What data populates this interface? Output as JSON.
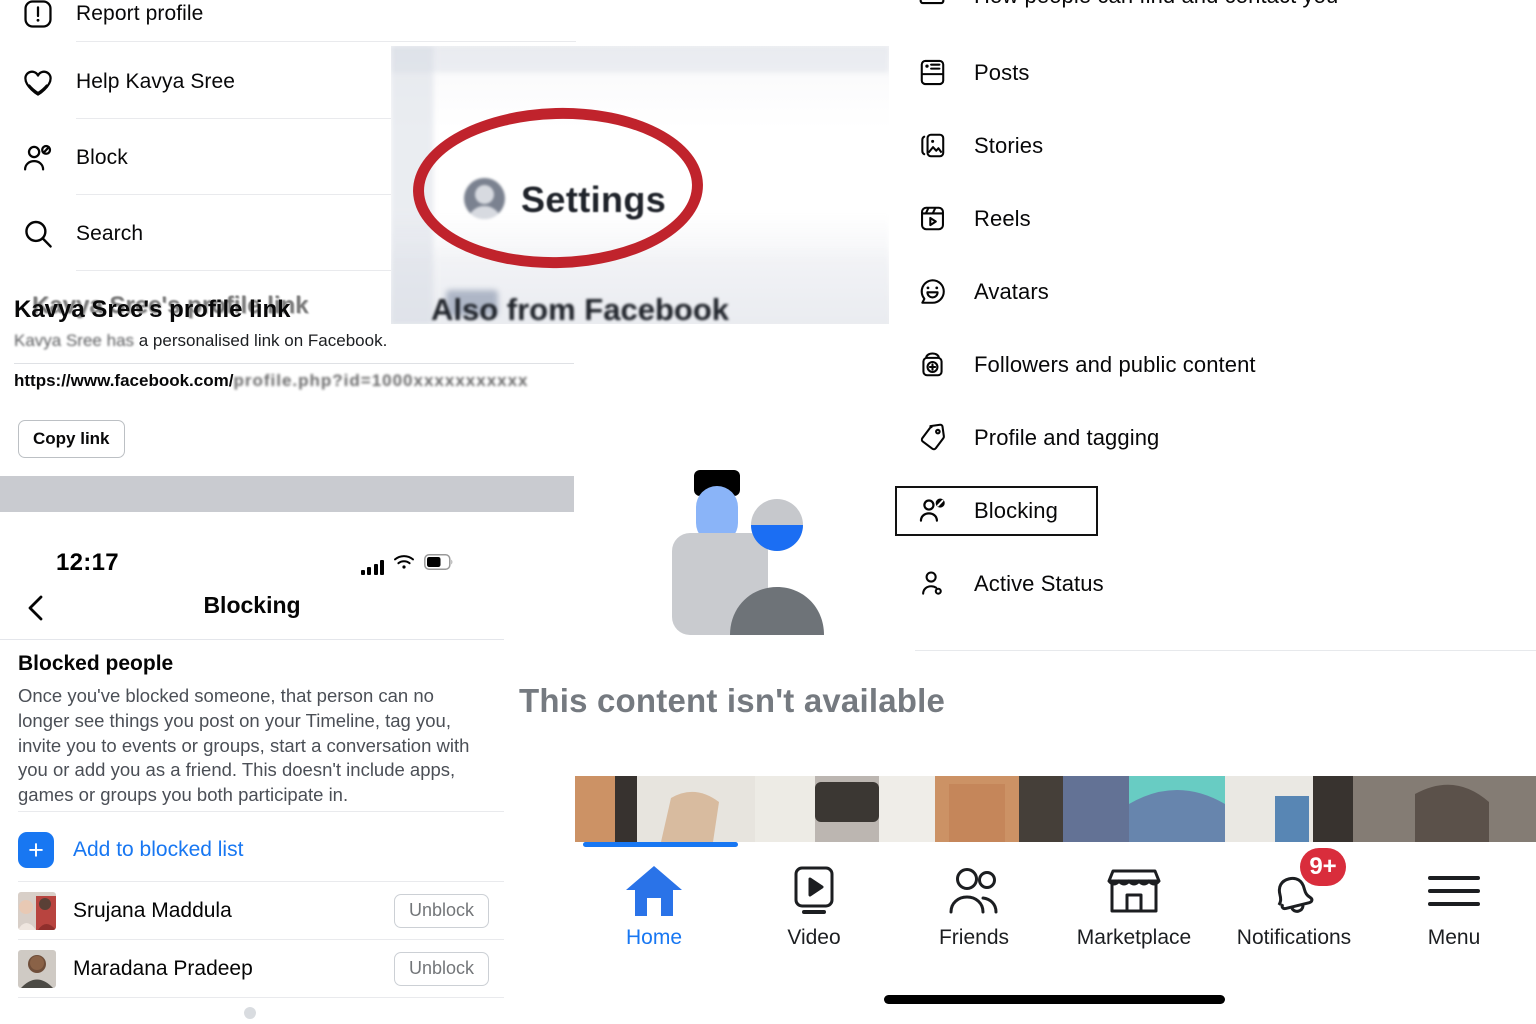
{
  "profile_menu": {
    "items": [
      {
        "label": "Report profile",
        "icon": "warning-icon"
      },
      {
        "label": "Help Kavya Sree",
        "icon": "heart-icon"
      },
      {
        "label": "Block",
        "icon": "block-user-icon"
      },
      {
        "label": "Search",
        "icon": "search-icon"
      }
    ],
    "profile_link": {
      "title": "Kavya Sree's profile link",
      "subtitle_blurred": "Kavya Sree",
      "subtitle_rest": " a personalised link on Facebook.",
      "url_prefix": "https://www.facebook.com/",
      "url_blurred": "profile.php?id=1000xxxxxxxxxxx",
      "copy_label": "Copy link"
    }
  },
  "settings_crop": {
    "label": "Settings",
    "below_label": "Also from Facebook",
    "highlight_color": "#c0232c"
  },
  "blocking_screen": {
    "status_bar": {
      "time": "12:17",
      "signal": "cellular-bars-icon",
      "wifi": "wifi-icon",
      "battery": "battery-icon"
    },
    "nav": {
      "back": "chevron-left-icon",
      "title": "Blocking"
    },
    "section_title": "Blocked people",
    "description": "Once you've blocked someone, that person can no longer see things you post on your Timeline, tag you, invite you to events or groups, start a conversation with you or add you as a friend. This doesn't include apps, games or groups you both participate in.",
    "add_label": "Add to blocked list",
    "blocked": [
      {
        "name": "Srujana Maddula",
        "action": "Unblock"
      },
      {
        "name": "Maradana Pradeep",
        "action": "Unblock"
      }
    ]
  },
  "settings_list": {
    "items": [
      {
        "label": "How people can find and contact you",
        "icon": "contact-icon"
      },
      {
        "label": "Posts",
        "icon": "posts-icon"
      },
      {
        "label": "Stories",
        "icon": "stories-icon"
      },
      {
        "label": "Reels",
        "icon": "reels-icon"
      },
      {
        "label": "Avatars",
        "icon": "avatar-icon"
      },
      {
        "label": "Followers and public content",
        "icon": "followers-icon"
      },
      {
        "label": "Profile and tagging",
        "icon": "tag-icon"
      },
      {
        "label": "Blocking",
        "icon": "block-user-icon"
      },
      {
        "label": "Active Status",
        "icon": "active-status-icon"
      }
    ],
    "highlighted": "Blocking"
  },
  "content_message": "This content isn't available",
  "bottom_nav": {
    "tabs": [
      {
        "label": "Home",
        "icon": "home-icon",
        "active": true
      },
      {
        "label": "Video",
        "icon": "video-icon",
        "active": false
      },
      {
        "label": "Friends",
        "icon": "friends-icon",
        "active": false
      },
      {
        "label": "Marketplace",
        "icon": "marketplace-icon",
        "active": false
      },
      {
        "label": "Notifications",
        "icon": "bell-icon",
        "active": false,
        "badge": "9+"
      },
      {
        "label": "Menu",
        "icon": "hamburger-icon",
        "active": false
      }
    ],
    "accent_color": "#1877f2",
    "badge_color": "#d92d3c"
  }
}
